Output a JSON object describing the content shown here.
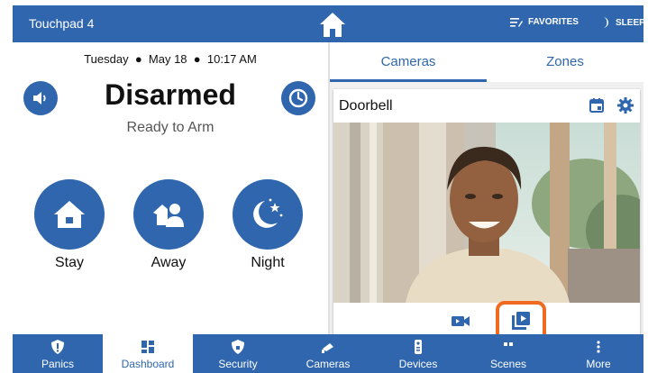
{
  "header": {
    "title": "Touchpad 4",
    "favorites_label": "FAVORITES",
    "sleep_label": "SLEEP"
  },
  "status_panel": {
    "day": "Tuesday",
    "date": "May 18",
    "time": "10:17 AM",
    "status": "Disarmed",
    "substatus": "Ready to Arm",
    "arm_buttons": [
      {
        "label": "Stay",
        "icon": "house-icon"
      },
      {
        "label": "Away",
        "icon": "people-icon"
      },
      {
        "label": "Night",
        "icon": "moon-icon"
      }
    ]
  },
  "tabs": [
    {
      "label": "Cameras",
      "active": true
    },
    {
      "label": "Zones",
      "active": false
    }
  ],
  "camera": {
    "name": "Doorbell"
  },
  "bottom_nav": [
    {
      "label": "Panics",
      "icon": "shield-alert-icon",
      "active": false
    },
    {
      "label": "Dashboard",
      "icon": "grid-icon",
      "active": true
    },
    {
      "label": "Security",
      "icon": "shield-icon",
      "active": false
    },
    {
      "label": "Cameras",
      "icon": "camera-icon",
      "active": false
    },
    {
      "label": "Devices",
      "icon": "remote-icon",
      "active": false
    },
    {
      "label": "Scenes",
      "icon": "scenes-icon",
      "active": false
    },
    {
      "label": "More",
      "icon": "more-icon",
      "active": false
    }
  ],
  "colors": {
    "brand_blue": "#2f66ad",
    "highlight_orange": "#f06a21"
  }
}
